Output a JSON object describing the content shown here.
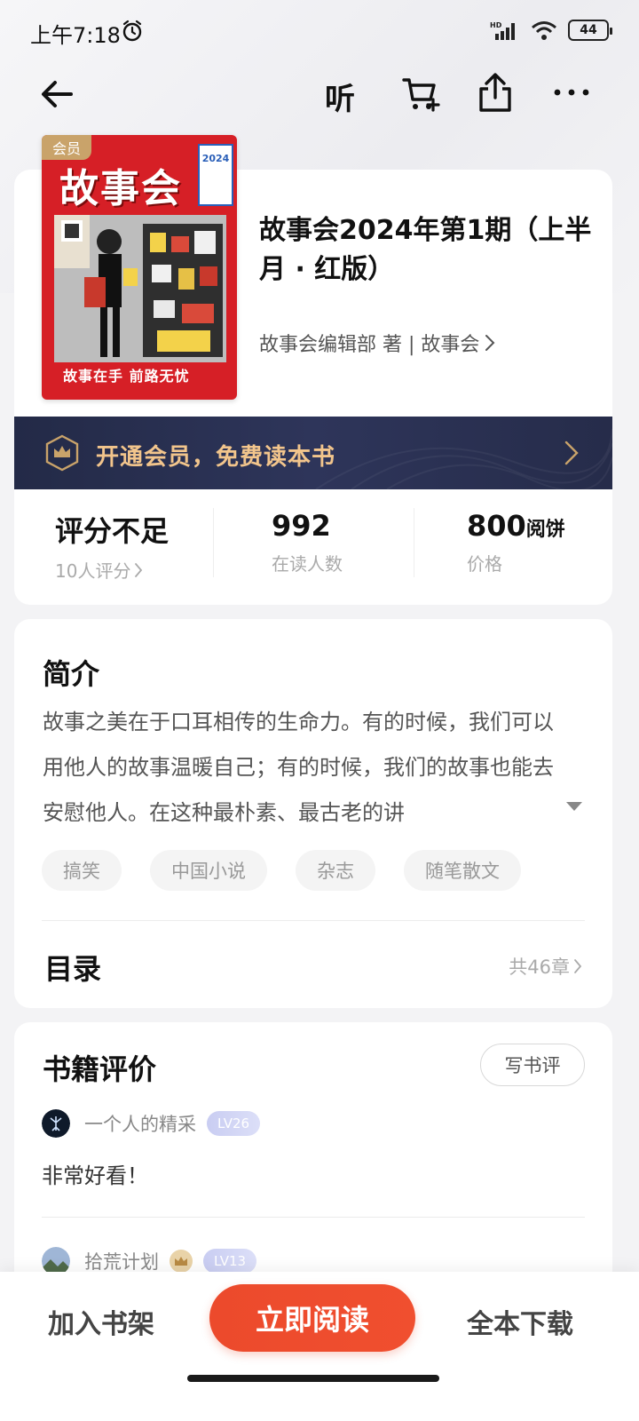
{
  "status_bar": {
    "time": "上午7:18",
    "battery": "44",
    "network": "HD"
  },
  "nav": {
    "listen_label": "听"
  },
  "book": {
    "cover_badge": "会员",
    "cover_logo": "故事会",
    "cover_year": "2024",
    "cover_slogan": "故事在手 前路无忧",
    "title": "故事会2024年第1期（上半月 · 红版）",
    "author_line": "故事会编辑部 著 | 故事会"
  },
  "vip_banner": {
    "text": "开通会员，免费读本书"
  },
  "stats": {
    "rating": {
      "value": "评分不足",
      "label": "10人评分"
    },
    "readers": {
      "value": "992",
      "label": "在读人数"
    },
    "price": {
      "value": "800",
      "unit": "阅饼",
      "label": "价格"
    }
  },
  "intro": {
    "title": "简介",
    "text": "故事之美在于口耳相传的生命力。有的时候，我们可以用他人的故事温暖自己；有的时候，我们的故事也能去安慰他人。在这种最朴素、最古老的讲",
    "tags": [
      "搞笑",
      "中国小说",
      "杂志",
      "随笔散文"
    ]
  },
  "toc": {
    "title": "目录",
    "count": "共46章"
  },
  "reviews": {
    "title": "书籍评价",
    "write_label": "写书评",
    "items": [
      {
        "user": "一个人的精采",
        "level": "LV26",
        "text": "非常好看！"
      },
      {
        "user": "拾荒计划",
        "level": "LV13",
        "text": ""
      }
    ]
  },
  "bottom_bar": {
    "shelf_label": "加入书架",
    "read_label": "立即阅读",
    "download_label": "全本下载"
  },
  "colors": {
    "accent": "#ec4a2c",
    "vip_bg": "#262c4a",
    "vip_text": "#f2c58c",
    "cover_red": "#d61f26"
  }
}
